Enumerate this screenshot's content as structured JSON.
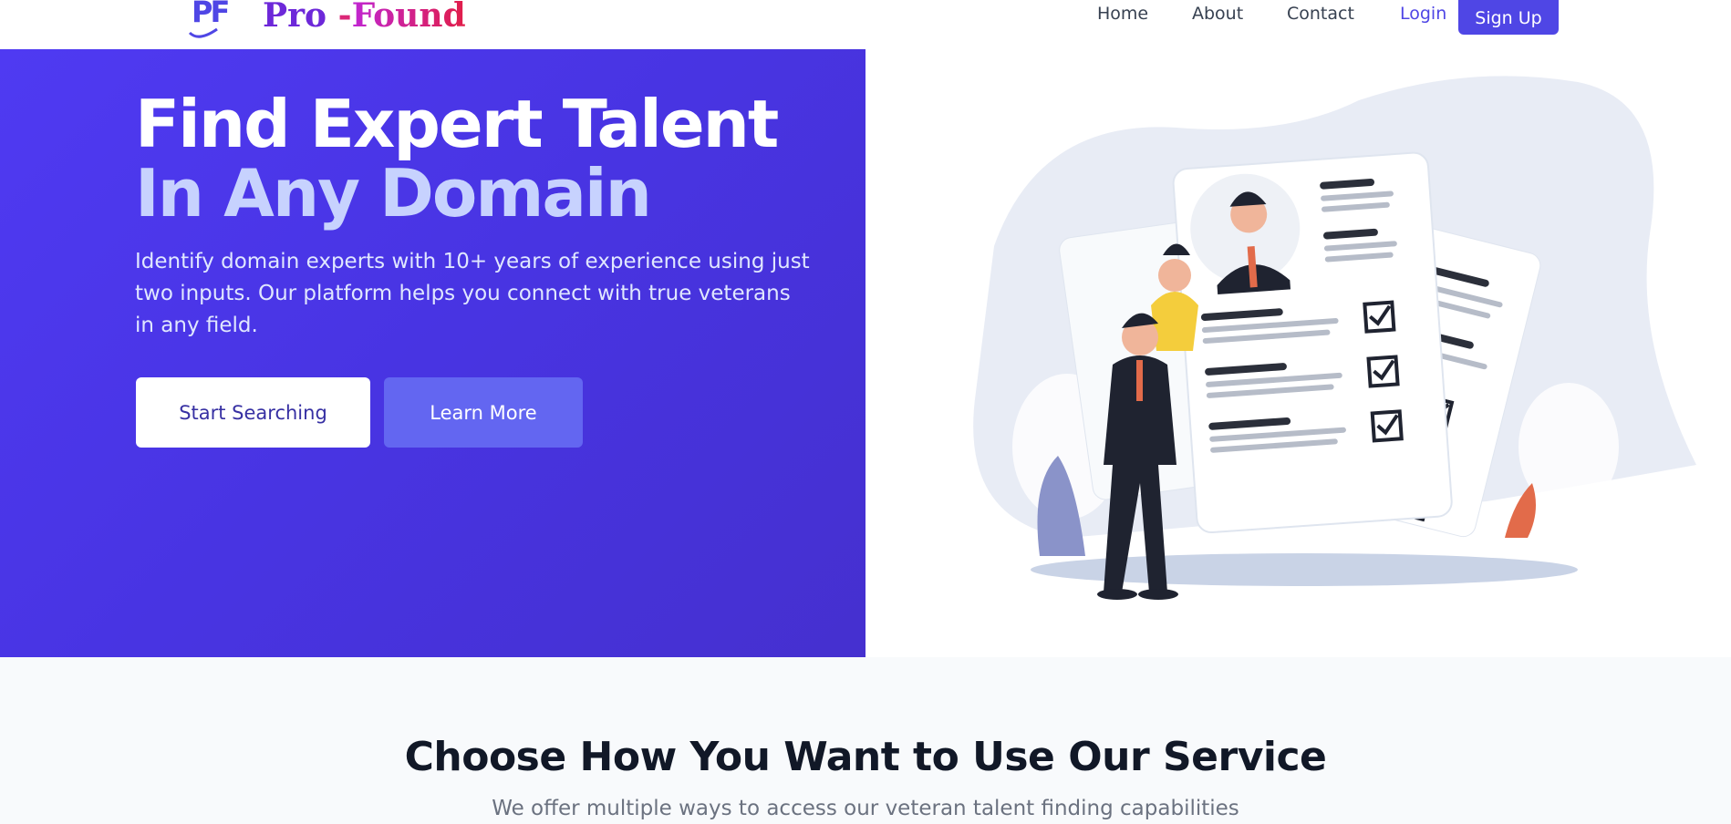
{
  "brand": {
    "mark": "PF",
    "name_part1": "Pro",
    "name_sep": "-",
    "name_part2": "Found"
  },
  "nav": {
    "home": "Home",
    "about": "About",
    "contact": "Contact",
    "login": "Login",
    "signup": "Sign Up"
  },
  "hero": {
    "title_line1": "Find Expert Talent",
    "title_line2": "In Any Domain",
    "description": "Identify domain experts with 10+ years of experience using just two inputs. Our platform helps you connect with true veterans in any field.",
    "primary_button": "Start Searching",
    "secondary_button": "Learn More"
  },
  "illustration": {
    "subject": "resume-review-illustration"
  },
  "service_section": {
    "title": "Choose How You Want to Use Our Service",
    "subtitle": "We offer multiple ways to access our veteran talent finding capabilities"
  },
  "colors": {
    "brand": "#4f46e5",
    "hero_bg": "#4834e2",
    "hero_title_accent": "#c7d2fe",
    "section_bg": "#f8fafc"
  }
}
